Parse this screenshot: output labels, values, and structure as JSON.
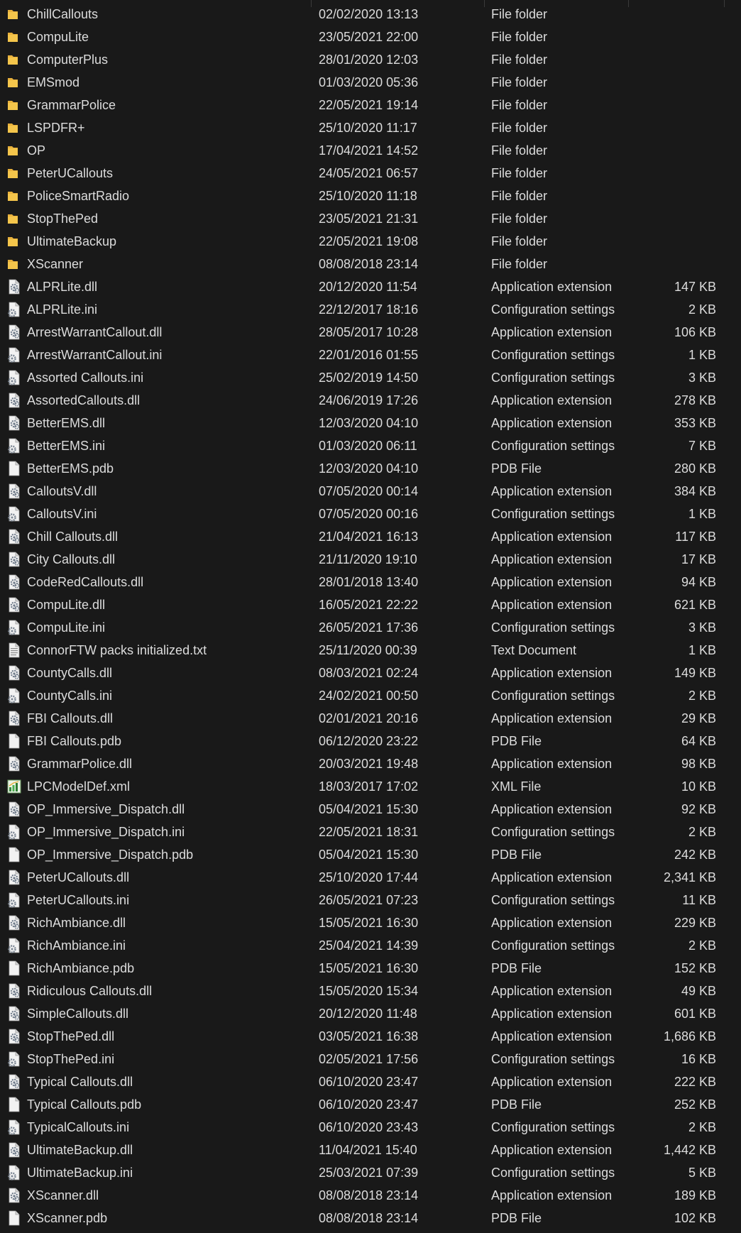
{
  "colors": {
    "background": "#191919",
    "text": "#dcdcdc",
    "folder": "#f4c54b",
    "file_page": "#f2f2f2",
    "gear": "#6f7b8a",
    "xml_green": "#3a8a3e"
  },
  "files": [
    {
      "name": "ChillCallouts",
      "date": "02/02/2020 13:13",
      "type": "File folder",
      "size": "",
      "icon": "folder-icon"
    },
    {
      "name": "CompuLite",
      "date": "23/05/2021 22:00",
      "type": "File folder",
      "size": "",
      "icon": "folder-icon"
    },
    {
      "name": "ComputerPlus",
      "date": "28/01/2020 12:03",
      "type": "File folder",
      "size": "",
      "icon": "folder-icon"
    },
    {
      "name": "EMSmod",
      "date": "01/03/2020 05:36",
      "type": "File folder",
      "size": "",
      "icon": "folder-icon"
    },
    {
      "name": "GrammarPolice",
      "date": "22/05/2021 19:14",
      "type": "File folder",
      "size": "",
      "icon": "folder-icon"
    },
    {
      "name": "LSPDFR+",
      "date": "25/10/2020 11:17",
      "type": "File folder",
      "size": "",
      "icon": "folder-icon"
    },
    {
      "name": "OP",
      "date": "17/04/2021 14:52",
      "type": "File folder",
      "size": "",
      "icon": "folder-icon"
    },
    {
      "name": "PeterUCallouts",
      "date": "24/05/2021 06:57",
      "type": "File folder",
      "size": "",
      "icon": "folder-icon"
    },
    {
      "name": "PoliceSmartRadio",
      "date": "25/10/2020 11:18",
      "type": "File folder",
      "size": "",
      "icon": "folder-icon"
    },
    {
      "name": "StopThePed",
      "date": "23/05/2021 21:31",
      "type": "File folder",
      "size": "",
      "icon": "folder-icon"
    },
    {
      "name": "UltimateBackup",
      "date": "22/05/2021 19:08",
      "type": "File folder",
      "size": "",
      "icon": "folder-icon"
    },
    {
      "name": "XScanner",
      "date": "08/08/2018 23:14",
      "type": "File folder",
      "size": "",
      "icon": "folder-icon"
    },
    {
      "name": "ALPRLite.dll",
      "date": "20/12/2020 11:54",
      "type": "Application extension",
      "size": "147 KB",
      "icon": "dll-icon"
    },
    {
      "name": "ALPRLite.ini",
      "date": "22/12/2017 18:16",
      "type": "Configuration settings",
      "size": "2 KB",
      "icon": "ini-icon"
    },
    {
      "name": "ArrestWarrantCallout.dll",
      "date": "28/05/2017 10:28",
      "type": "Application extension",
      "size": "106 KB",
      "icon": "dll-icon"
    },
    {
      "name": "ArrestWarrantCallout.ini",
      "date": "22/01/2016 01:55",
      "type": "Configuration settings",
      "size": "1 KB",
      "icon": "ini-icon"
    },
    {
      "name": "Assorted Callouts.ini",
      "date": "25/02/2019 14:50",
      "type": "Configuration settings",
      "size": "3 KB",
      "icon": "ini-icon"
    },
    {
      "name": "AssortedCallouts.dll",
      "date": "24/06/2019 17:26",
      "type": "Application extension",
      "size": "278 KB",
      "icon": "dll-icon"
    },
    {
      "name": "BetterEMS.dll",
      "date": "12/03/2020 04:10",
      "type": "Application extension",
      "size": "353 KB",
      "icon": "dll-icon"
    },
    {
      "name": "BetterEMS.ini",
      "date": "01/03/2020 06:11",
      "type": "Configuration settings",
      "size": "7 KB",
      "icon": "ini-icon"
    },
    {
      "name": "BetterEMS.pdb",
      "date": "12/03/2020 04:10",
      "type": "PDB File",
      "size": "280 KB",
      "icon": "pdb-icon"
    },
    {
      "name": "CalloutsV.dll",
      "date": "07/05/2020 00:14",
      "type": "Application extension",
      "size": "384 KB",
      "icon": "dll-icon"
    },
    {
      "name": "CalloutsV.ini",
      "date": "07/05/2020 00:16",
      "type": "Configuration settings",
      "size": "1 KB",
      "icon": "ini-icon"
    },
    {
      "name": "Chill Callouts.dll",
      "date": "21/04/2021 16:13",
      "type": "Application extension",
      "size": "117 KB",
      "icon": "dll-icon"
    },
    {
      "name": "City Callouts.dll",
      "date": "21/11/2020 19:10",
      "type": "Application extension",
      "size": "17 KB",
      "icon": "dll-icon"
    },
    {
      "name": "CodeRedCallouts.dll",
      "date": "28/01/2018 13:40",
      "type": "Application extension",
      "size": "94 KB",
      "icon": "dll-icon"
    },
    {
      "name": "CompuLite.dll",
      "date": "16/05/2021 22:22",
      "type": "Application extension",
      "size": "621 KB",
      "icon": "dll-icon"
    },
    {
      "name": "CompuLite.ini",
      "date": "26/05/2021 17:36",
      "type": "Configuration settings",
      "size": "3 KB",
      "icon": "ini-icon"
    },
    {
      "name": "ConnorFTW packs initialized.txt",
      "date": "25/11/2020 00:39",
      "type": "Text Document",
      "size": "1 KB",
      "icon": "txt-icon"
    },
    {
      "name": "CountyCalls.dll",
      "date": "08/03/2021 02:24",
      "type": "Application extension",
      "size": "149 KB",
      "icon": "dll-icon"
    },
    {
      "name": "CountyCalls.ini",
      "date": "24/02/2021 00:50",
      "type": "Configuration settings",
      "size": "2 KB",
      "icon": "ini-icon"
    },
    {
      "name": "FBI Callouts.dll",
      "date": "02/01/2021 20:16",
      "type": "Application extension",
      "size": "29 KB",
      "icon": "dll-icon"
    },
    {
      "name": "FBI Callouts.pdb",
      "date": "06/12/2020 23:22",
      "type": "PDB File",
      "size": "64 KB",
      "icon": "pdb-icon"
    },
    {
      "name": "GrammarPolice.dll",
      "date": "20/03/2021 19:48",
      "type": "Application extension",
      "size": "98 KB",
      "icon": "dll-icon"
    },
    {
      "name": "LPCModelDef.xml",
      "date": "18/03/2017 17:02",
      "type": "XML File",
      "size": "10 KB",
      "icon": "xml-icon"
    },
    {
      "name": "OP_Immersive_Dispatch.dll",
      "date": "05/04/2021 15:30",
      "type": "Application extension",
      "size": "92 KB",
      "icon": "dll-icon"
    },
    {
      "name": "OP_Immersive_Dispatch.ini",
      "date": "22/05/2021 18:31",
      "type": "Configuration settings",
      "size": "2 KB",
      "icon": "ini-icon"
    },
    {
      "name": "OP_Immersive_Dispatch.pdb",
      "date": "05/04/2021 15:30",
      "type": "PDB File",
      "size": "242 KB",
      "icon": "pdb-icon"
    },
    {
      "name": "PeterUCallouts.dll",
      "date": "25/10/2020 17:44",
      "type": "Application extension",
      "size": "2,341 KB",
      "icon": "dll-icon"
    },
    {
      "name": "PeterUCallouts.ini",
      "date": "26/05/2021 07:23",
      "type": "Configuration settings",
      "size": "11 KB",
      "icon": "ini-icon"
    },
    {
      "name": "RichAmbiance.dll",
      "date": "15/05/2021 16:30",
      "type": "Application extension",
      "size": "229 KB",
      "icon": "dll-icon"
    },
    {
      "name": "RichAmbiance.ini",
      "date": "25/04/2021 14:39",
      "type": "Configuration settings",
      "size": "2 KB",
      "icon": "ini-icon"
    },
    {
      "name": "RichAmbiance.pdb",
      "date": "15/05/2021 16:30",
      "type": "PDB File",
      "size": "152 KB",
      "icon": "pdb-icon"
    },
    {
      "name": "Ridiculous Callouts.dll",
      "date": "15/05/2020 15:34",
      "type": "Application extension",
      "size": "49 KB",
      "icon": "dll-icon"
    },
    {
      "name": "SimpleCallouts.dll",
      "date": "20/12/2020 11:48",
      "type": "Application extension",
      "size": "601 KB",
      "icon": "dll-icon"
    },
    {
      "name": "StopThePed.dll",
      "date": "03/05/2021 16:38",
      "type": "Application extension",
      "size": "1,686 KB",
      "icon": "dll-icon"
    },
    {
      "name": "StopThePed.ini",
      "date": "02/05/2021 17:56",
      "type": "Configuration settings",
      "size": "16 KB",
      "icon": "ini-icon"
    },
    {
      "name": "Typical Callouts.dll",
      "date": "06/10/2020 23:47",
      "type": "Application extension",
      "size": "222 KB",
      "icon": "dll-icon"
    },
    {
      "name": "Typical Callouts.pdb",
      "date": "06/10/2020 23:47",
      "type": "PDB File",
      "size": "252 KB",
      "icon": "pdb-icon"
    },
    {
      "name": "TypicalCallouts.ini",
      "date": "06/10/2020 23:43",
      "type": "Configuration settings",
      "size": "2 KB",
      "icon": "ini-icon"
    },
    {
      "name": "UltimateBackup.dll",
      "date": "11/04/2021 15:40",
      "type": "Application extension",
      "size": "1,442 KB",
      "icon": "dll-icon"
    },
    {
      "name": "UltimateBackup.ini",
      "date": "25/03/2021 07:39",
      "type": "Configuration settings",
      "size": "5 KB",
      "icon": "ini-icon"
    },
    {
      "name": "XScanner.dll",
      "date": "08/08/2018 23:14",
      "type": "Application extension",
      "size": "189 KB",
      "icon": "dll-icon"
    },
    {
      "name": "XScanner.pdb",
      "date": "08/08/2018 23:14",
      "type": "PDB File",
      "size": "102 KB",
      "icon": "pdb-icon"
    }
  ]
}
